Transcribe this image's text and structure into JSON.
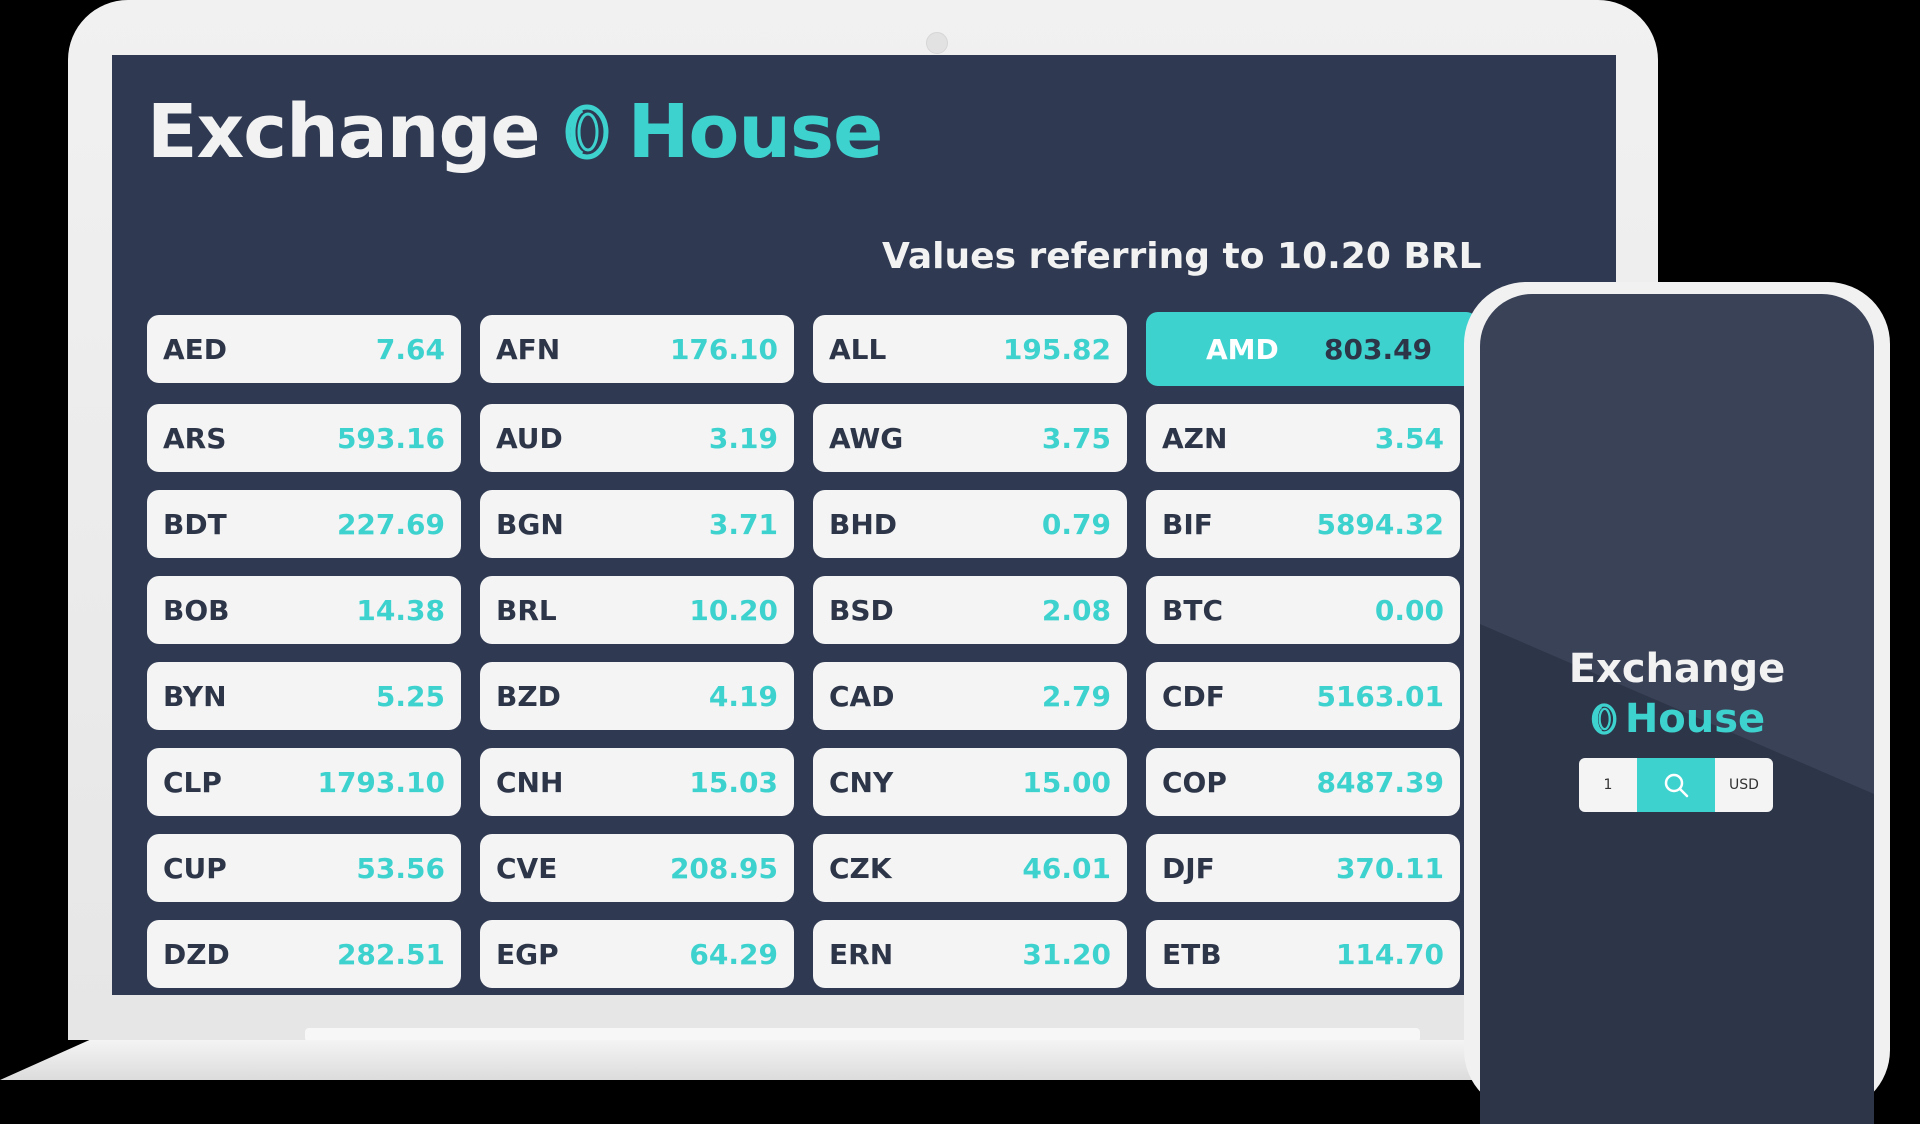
{
  "app": {
    "brand_word1": "Exchange",
    "brand_word2": "House",
    "accent_color": "#3ed2cf",
    "background_color": "#2f3a52"
  },
  "subtitle": "Values referring to 10.20 BRL",
  "selected_code": "AMD",
  "rates": [
    {
      "code": "AED",
      "value": "7.64"
    },
    {
      "code": "AFN",
      "value": "176.10"
    },
    {
      "code": "ALL",
      "value": "195.82"
    },
    {
      "code": "AMD",
      "value": "803.49"
    },
    {
      "code": "ARS",
      "value": "593.16"
    },
    {
      "code": "AUD",
      "value": "3.19"
    },
    {
      "code": "AWG",
      "value": "3.75"
    },
    {
      "code": "AZN",
      "value": "3.54"
    },
    {
      "code": "BDT",
      "value": "227.69"
    },
    {
      "code": "BGN",
      "value": "3.71"
    },
    {
      "code": "BHD",
      "value": "0.79"
    },
    {
      "code": "BIF",
      "value": "5894.32"
    },
    {
      "code": "BOB",
      "value": "14.38"
    },
    {
      "code": "BRL",
      "value": "10.20"
    },
    {
      "code": "BSD",
      "value": "2.08"
    },
    {
      "code": "BTC",
      "value": "0.00"
    },
    {
      "code": "BYN",
      "value": "5.25"
    },
    {
      "code": "BZD",
      "value": "4.19"
    },
    {
      "code": "CAD",
      "value": "2.79"
    },
    {
      "code": "CDF",
      "value": "5163.01"
    },
    {
      "code": "CLP",
      "value": "1793.10"
    },
    {
      "code": "CNH",
      "value": "15.03"
    },
    {
      "code": "CNY",
      "value": "15.00"
    },
    {
      "code": "COP",
      "value": "8487.39"
    },
    {
      "code": "CUP",
      "value": "53.56"
    },
    {
      "code": "CVE",
      "value": "208.95"
    },
    {
      "code": "CZK",
      "value": "46.01"
    },
    {
      "code": "DJF",
      "value": "370.11"
    },
    {
      "code": "DZD",
      "value": "282.51"
    },
    {
      "code": "EGP",
      "value": "64.29"
    },
    {
      "code": "ERN",
      "value": "31.20"
    },
    {
      "code": "ETB",
      "value": "114.70"
    }
  ],
  "mobile": {
    "brand_word1": "Exchange",
    "brand_word2": "House",
    "amount_value": "1",
    "search_icon": "search-icon",
    "currency_value": "USD"
  }
}
